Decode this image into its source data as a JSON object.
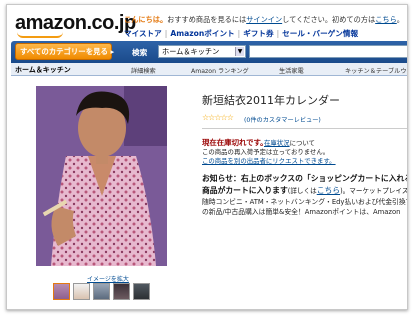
{
  "header": {
    "logo_text": "amazon.co.jp",
    "greeting_hello": "こんにちは。",
    "greeting_text": "おすすめ商品を見るには",
    "signin_link": "サインイン",
    "greeting_text2": "してください。初めての方は",
    "here_link": "こちら",
    "greeting_end": "。",
    "links": [
      "マイストア",
      "Amazonポイント",
      "ギフト券",
      "セール・バーゲン情報"
    ]
  },
  "navbar": {
    "category_button": "すべてのカテゴリーを見る",
    "search_label": "検索",
    "search_select": "ホーム＆キッチン",
    "search_input_value": ""
  },
  "subnav": {
    "home": "ホーム＆キッチン",
    "items": [
      "詳細検索",
      "Amazon ランキング",
      "生活家電",
      "キッチン＆テーブルウェア"
    ]
  },
  "product": {
    "title": "新垣結衣2011年カレンダー",
    "stars": "☆☆☆☆☆",
    "review_link": "(0件のカスタマーレビュー)",
    "stock_status": "現在在庫切れです。",
    "stock_side_link": "在庫状況",
    "stock_side_text": "について",
    "stock_line2": "この商品の再入荷予定は立っておりません。",
    "stock_line3": "この商品を別の出品者にリクエストできます。",
    "enlarge_link": "イメージを拡大",
    "thumbnail_count": 5
  },
  "notice": {
    "line1": "お知らせ：右上のボックスの「ショッピングカートに入れる」ボタ",
    "line2_bold": "商品がカートに入ります",
    "line2_small": "(詳しくは",
    "line2_link": "こちら",
    "line2_end": ")。マーケットプレイスの",
    "line3": "随時コンビニ・ATM・ネットバンキング・Edy払いおよび代金引換で",
    "line4": "の新品/中古品購入は簡単&安全！Amazonポイントは、Amazon"
  },
  "colors": {
    "accent_orange": "#e47911",
    "nav_blue": "#1a4a8a",
    "link_blue": "#004b91",
    "stock_red": "#990000"
  }
}
